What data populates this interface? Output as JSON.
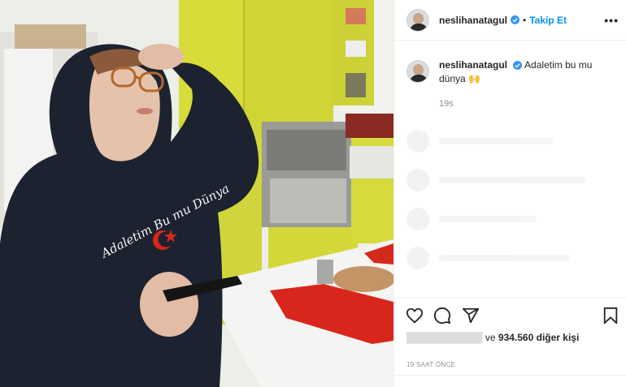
{
  "post": {
    "username": "neslihanatagul",
    "separator": "•",
    "follow_label": "Takip Et",
    "more_label": "•••",
    "caption_text": "Adaletim bu mu dünya 🙌",
    "caption_time": "19s",
    "likes_prefix": "ve",
    "likes_count": "934.560",
    "likes_suffix": "diğer kişi",
    "posted_ago": "19 SAAT ÖNCE"
  },
  "photo": {
    "hoodie_text": "Adaletim Bu mu Dünya"
  },
  "icons": {
    "verified": "verified-badge-icon",
    "like": "heart-icon",
    "comment": "comment-bubble-icon",
    "share": "paper-plane-icon",
    "save": "bookmark-icon",
    "more": "more-options-icon"
  },
  "colors": {
    "accent": "#0095f6",
    "verified": "#3897f0",
    "cabinet": "#d8dc3c",
    "hoodie": "#1c2230",
    "tray": "#d9261c"
  }
}
